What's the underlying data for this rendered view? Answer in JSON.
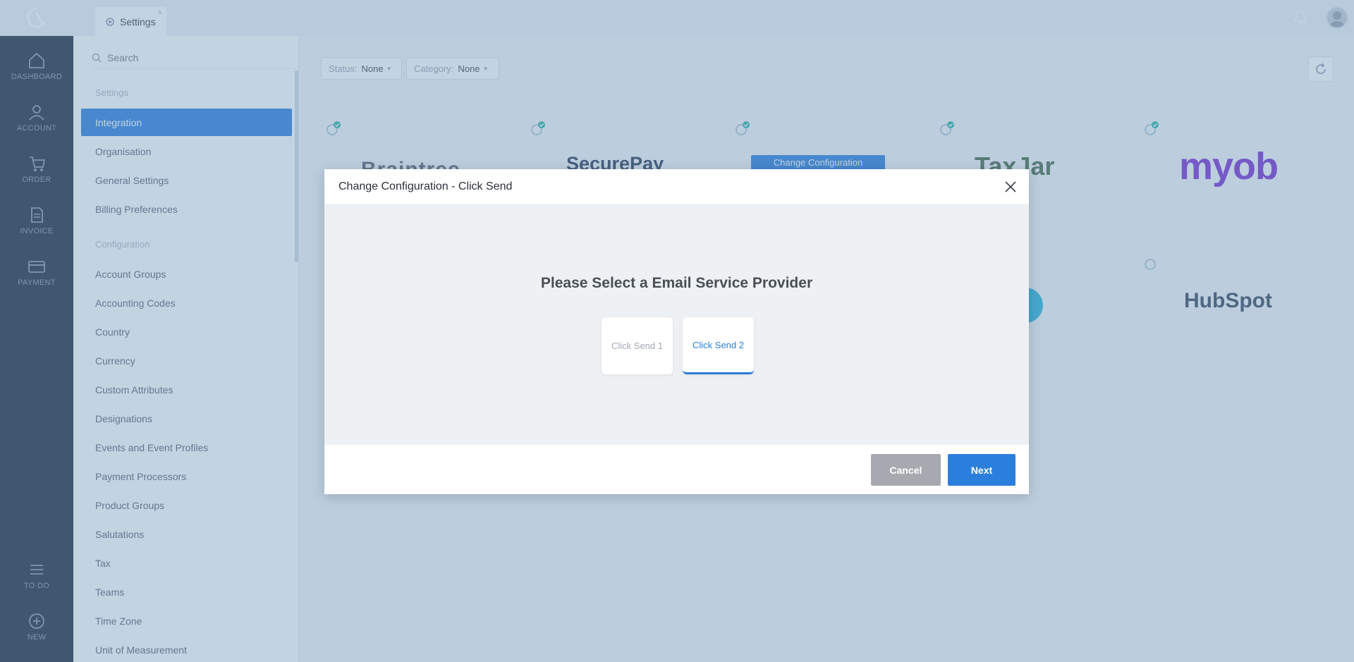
{
  "topbar": {
    "tab_label": "Settings",
    "tab_close": "×"
  },
  "nav": {
    "items": [
      {
        "label": "DASHBOARD",
        "icon": "home-icon"
      },
      {
        "label": "ACCOUNT",
        "icon": "user-icon"
      },
      {
        "label": "ORDER",
        "icon": "cart-icon"
      },
      {
        "label": "INVOICE",
        "icon": "document-icon"
      },
      {
        "label": "PAYMENT",
        "icon": "card-icon"
      },
      {
        "label": "TO DO",
        "icon": "list-icon"
      },
      {
        "label": "NEW",
        "icon": "plus-icon"
      }
    ]
  },
  "sidebar": {
    "search_placeholder": "Search",
    "settings_heading": "Settings",
    "settings_items": [
      "Integration",
      "Organisation",
      "General Settings",
      "Billing Preferences"
    ],
    "configuration_heading": "Configuration",
    "configuration_items": [
      "Account Groups",
      "Accounting Codes",
      "Country",
      "Currency",
      "Custom Attributes",
      "Designations",
      "Events and Event Profiles",
      "Payment Processors",
      "Product Groups",
      "Salutations",
      "Tax",
      "Teams",
      "Time Zone",
      "Unit of Measurement"
    ]
  },
  "filters": {
    "status_label": "Status:",
    "status_value": "None",
    "category_label": "Category:",
    "category_value": "None"
  },
  "integrations": {
    "brands": [
      "Braintree",
      "SecurePay",
      "TaxJar",
      "myob",
      "HubSpot"
    ],
    "card_button": "Change Configuration"
  },
  "modal": {
    "title": "Change Configuration - Click Send",
    "prompt": "Please Select a Email Service Provider",
    "options": [
      "Click Send 1",
      "Click Send 2"
    ],
    "selected_option": "Click Send 2",
    "cancel_label": "Cancel",
    "next_label": "Next"
  },
  "colors": {
    "primary": "#2b7fdc",
    "cancel_gray": "#a6aab0"
  }
}
